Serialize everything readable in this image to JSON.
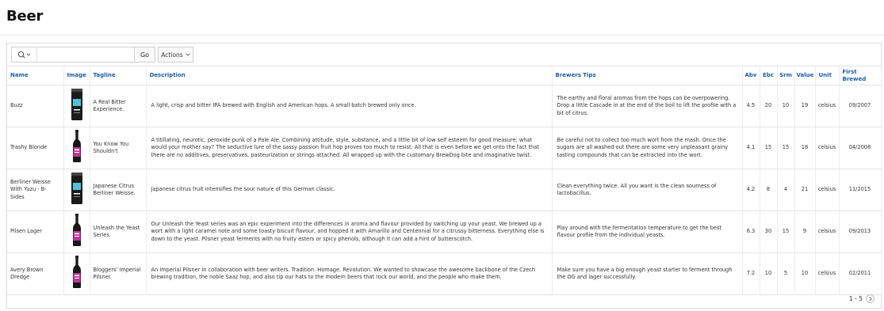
{
  "page_title": "Beer",
  "toolbar": {
    "search_icon": "search-icon",
    "search_value": "",
    "search_placeholder": "",
    "go_label": "Go",
    "actions_label": "Actions"
  },
  "columns": {
    "name": "Name",
    "image": "Image",
    "tagline": "Tagline",
    "description": "Description",
    "tips": "Brewers Tips",
    "abv": "Abv",
    "ebc": "Ebc",
    "srm": "Srm",
    "value": "Value",
    "unit": "Unit",
    "first_brewed": "First Brewed"
  },
  "rows": [
    {
      "name": "Buzz",
      "image": "can-image",
      "tagline": "A Real Bitter Experience.",
      "description": "A light, crisp and bitter IPA brewed with English and American hops. A small batch brewed only once.",
      "tips": "The earthy and floral aromas from the hops can be overpowering. Drop a little Cascade in at the end of the boil to lift the profile with a bit of citrus.",
      "abv": "4.5",
      "ebc": "20",
      "srm": "10",
      "value": "19",
      "unit": "celsius",
      "first_brewed": "09/2007"
    },
    {
      "name": "Trashy Blonde",
      "image": "bottle-image",
      "tagline": "You Know You Shouldn't",
      "description": "A titillating, neurotic, peroxide punk of a Pale Ale. Combining attitude, style, substance, and a little bit of low self esteem for good measure; what would your mother say? The seductive lure of the sassy passion fruit hop proves too much to resist. All that is even before we get onto the fact that there are no additives, preservatives, pasteurization or strings attached. All wrapped up with the customary BrewDog bite and imaginative twist.",
      "tips": "Be careful not to collect too much wort from the mash. Once the sugars are all washed out there are some very unpleasant grainy tasting compounds that can be extracted into the wort.",
      "abv": "4.1",
      "ebc": "15",
      "srm": "15",
      "value": "18",
      "unit": "celsius",
      "first_brewed": "04/2008"
    },
    {
      "name": "Berliner Weisse With Yuzu - B-Sides",
      "image": "can-image",
      "tagline": "Japanese Citrus Berliner Weisse.",
      "description": "Japanese citrus fruit intensifies the sour nature of this German classic.",
      "tips": "Clean everything twice. All you want is the clean sourness of lactobacillus.",
      "abv": "4.2",
      "ebc": "8",
      "srm": "4",
      "value": "21",
      "unit": "celsius",
      "first_brewed": "11/2015"
    },
    {
      "name": "Pilsen Lager",
      "image": "bottle-image",
      "tagline": "Unleash the Yeast Series.",
      "description": "Our Unleash the Yeast series was an epic experiment into the differences in aroma and flavour provided by switching up your yeast. We brewed up a wort with a light caramel note and some toasty biscuit flavour, and hopped it with Amarillo and Centennial for a citrussy bitterness. Everything else is down to the yeast. Pilsner yeast ferments with no fruity esters or spicy phenols, although it can add a hint of butterscotch.",
      "tips": "Play around with the fermentation temperature to get the best flavour profile from the individual yeasts.",
      "abv": "6.3",
      "ebc": "30",
      "srm": "15",
      "value": "9",
      "unit": "celsius",
      "first_brewed": "09/2013"
    },
    {
      "name": "Avery Brown Dredge",
      "image": "bottle-image",
      "tagline": "Bloggers' Imperial Pilsner.",
      "description": "An Imperial Pilsner in collaboration with beer writers. Tradition. Homage. Revolution. We wanted to showcase the awesome backbone of the Czech brewing tradition, the noble Saaz hop, and also tip our hats to the modern beers that rock our world, and the people who make them.",
      "tips": "Make sure you have a big enough yeast starter to ferment through the OG and lager successfully.",
      "abv": "7.2",
      "ebc": "10",
      "srm": "5",
      "value": "10",
      "unit": "celsius",
      "first_brewed": "02/2011"
    }
  ],
  "pagination": {
    "range": "1 - 5"
  },
  "colors": {
    "header_link": "#1a5fa8",
    "border": "#e4e4e4"
  }
}
